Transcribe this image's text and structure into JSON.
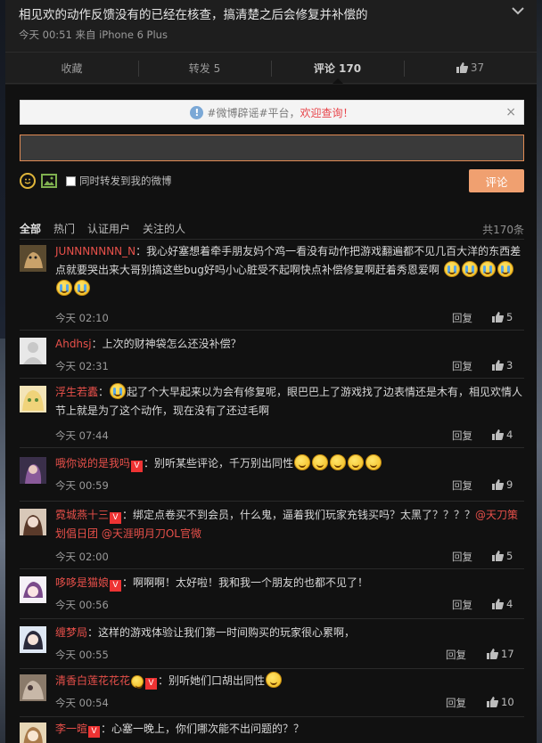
{
  "post": {
    "text": "相见欢的动作反馈没有的已经在核查，搞清楚之后会修复并补偿的",
    "meta": "今天 00:51 来自 iPhone 6 Plus"
  },
  "tabs": [
    {
      "label": "收藏"
    },
    {
      "label": "转发 5"
    },
    {
      "label": "评论 170"
    },
    {
      "label": "37"
    }
  ],
  "notice": {
    "prefix": "#微博辟谣#平台，",
    "highlight": "欢迎查询！",
    "close": "×"
  },
  "composer": {
    "input_value": "",
    "forward_label": "同时转发到我的微博",
    "submit_label": "评论"
  },
  "filters": [
    "全部",
    "热门",
    "认证用户",
    "关注的人"
  ],
  "total": "共170条",
  "reply_label": "回复",
  "comments": [
    {
      "user": "JUNNNNNNN_N",
      "vip": false,
      "text": "：我心好塞想着牵手朋友妈个鸡一看没有动作把游戏翻遍都不见几百大洋的东西差点就要哭出来大哥别搞这些bug好吗小心脏受不起啊快点补偿修复啊赶着秀恩爱啊",
      "time": "今天 02:10",
      "likes": "5"
    },
    {
      "user": "Ahdhsj",
      "vip": false,
      "text": "：上次的财神袋怎么还没补偿？",
      "time": "今天 02:31",
      "likes": "3"
    },
    {
      "user": "浮生若蠹",
      "vip": false,
      "text_a": "：",
      "text_b": "起了个大早起来以为会有修复呢，眼巴巴上了游戏找了边表情还是木有，相见欢情人节上就是为了这个动作，现在没有了还过毛啊",
      "time": "今天 07:44",
      "likes": "4"
    },
    {
      "user": "哦你说的是我吗",
      "vip": true,
      "text": "：别听某些评论，千万别出同性",
      "time": "今天 00:59",
      "likes": "9"
    },
    {
      "user": "霓城燕十三",
      "vip": true,
      "text": "：绑定点卷买不到会员，什么鬼，逼着我们玩家充钱买吗？太黑了？？？？",
      "mention1": "@天刀策划倡日团",
      "mention2": "@天涯明月刀OL官微",
      "time": "今天 02:00",
      "likes": "5"
    },
    {
      "user": "哆哆是猫娘",
      "vip": true,
      "text": "：啊啊啊！太好啦！我和我一个朋友的也都不见了！",
      "time": "今天 00:56",
      "likes": "4"
    },
    {
      "user": "缠梦局",
      "vip": false,
      "text": "：这样的游戏体验让我们第一时间购买的玩家很心累啊，",
      "time": "今天 00:55",
      "likes": "17"
    },
    {
      "user": "清香白莲花花花",
      "vip": true,
      "text": "：别听她们口胡出同性",
      "time": "今天 00:54",
      "likes": "10"
    },
    {
      "user": "李一暄",
      "vip": true,
      "text": "：心塞一晚上，你们哪次能不出问题的？？"
    }
  ]
}
